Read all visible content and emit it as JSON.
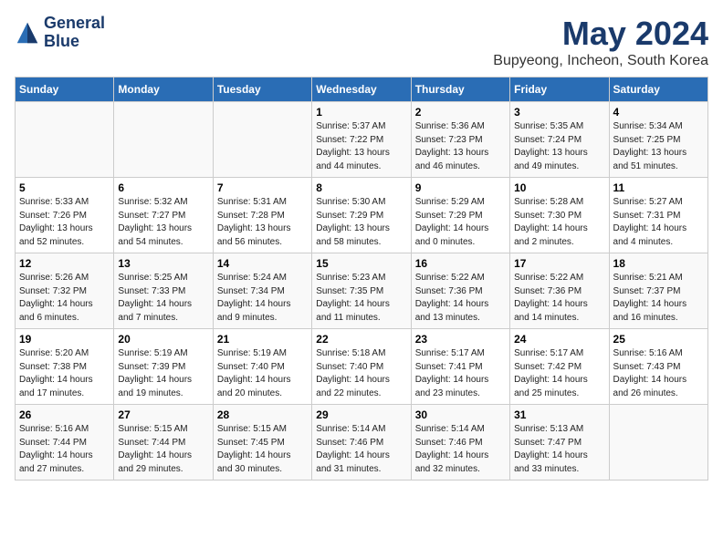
{
  "logo": {
    "line1": "General",
    "line2": "Blue"
  },
  "title": "May 2024",
  "location": "Bupyeong, Incheon, South Korea",
  "weekdays": [
    "Sunday",
    "Monday",
    "Tuesday",
    "Wednesday",
    "Thursday",
    "Friday",
    "Saturday"
  ],
  "weeks": [
    [
      {
        "day": "",
        "info": ""
      },
      {
        "day": "",
        "info": ""
      },
      {
        "day": "",
        "info": ""
      },
      {
        "day": "1",
        "info": "Sunrise: 5:37 AM\nSunset: 7:22 PM\nDaylight: 13 hours\nand 44 minutes."
      },
      {
        "day": "2",
        "info": "Sunrise: 5:36 AM\nSunset: 7:23 PM\nDaylight: 13 hours\nand 46 minutes."
      },
      {
        "day": "3",
        "info": "Sunrise: 5:35 AM\nSunset: 7:24 PM\nDaylight: 13 hours\nand 49 minutes."
      },
      {
        "day": "4",
        "info": "Sunrise: 5:34 AM\nSunset: 7:25 PM\nDaylight: 13 hours\nand 51 minutes."
      }
    ],
    [
      {
        "day": "5",
        "info": "Sunrise: 5:33 AM\nSunset: 7:26 PM\nDaylight: 13 hours\nand 52 minutes."
      },
      {
        "day": "6",
        "info": "Sunrise: 5:32 AM\nSunset: 7:27 PM\nDaylight: 13 hours\nand 54 minutes."
      },
      {
        "day": "7",
        "info": "Sunrise: 5:31 AM\nSunset: 7:28 PM\nDaylight: 13 hours\nand 56 minutes."
      },
      {
        "day": "8",
        "info": "Sunrise: 5:30 AM\nSunset: 7:29 PM\nDaylight: 13 hours\nand 58 minutes."
      },
      {
        "day": "9",
        "info": "Sunrise: 5:29 AM\nSunset: 7:29 PM\nDaylight: 14 hours\nand 0 minutes."
      },
      {
        "day": "10",
        "info": "Sunrise: 5:28 AM\nSunset: 7:30 PM\nDaylight: 14 hours\nand 2 minutes."
      },
      {
        "day": "11",
        "info": "Sunrise: 5:27 AM\nSunset: 7:31 PM\nDaylight: 14 hours\nand 4 minutes."
      }
    ],
    [
      {
        "day": "12",
        "info": "Sunrise: 5:26 AM\nSunset: 7:32 PM\nDaylight: 14 hours\nand 6 minutes."
      },
      {
        "day": "13",
        "info": "Sunrise: 5:25 AM\nSunset: 7:33 PM\nDaylight: 14 hours\nand 7 minutes."
      },
      {
        "day": "14",
        "info": "Sunrise: 5:24 AM\nSunset: 7:34 PM\nDaylight: 14 hours\nand 9 minutes."
      },
      {
        "day": "15",
        "info": "Sunrise: 5:23 AM\nSunset: 7:35 PM\nDaylight: 14 hours\nand 11 minutes."
      },
      {
        "day": "16",
        "info": "Sunrise: 5:22 AM\nSunset: 7:36 PM\nDaylight: 14 hours\nand 13 minutes."
      },
      {
        "day": "17",
        "info": "Sunrise: 5:22 AM\nSunset: 7:36 PM\nDaylight: 14 hours\nand 14 minutes."
      },
      {
        "day": "18",
        "info": "Sunrise: 5:21 AM\nSunset: 7:37 PM\nDaylight: 14 hours\nand 16 minutes."
      }
    ],
    [
      {
        "day": "19",
        "info": "Sunrise: 5:20 AM\nSunset: 7:38 PM\nDaylight: 14 hours\nand 17 minutes."
      },
      {
        "day": "20",
        "info": "Sunrise: 5:19 AM\nSunset: 7:39 PM\nDaylight: 14 hours\nand 19 minutes."
      },
      {
        "day": "21",
        "info": "Sunrise: 5:19 AM\nSunset: 7:40 PM\nDaylight: 14 hours\nand 20 minutes."
      },
      {
        "day": "22",
        "info": "Sunrise: 5:18 AM\nSunset: 7:40 PM\nDaylight: 14 hours\nand 22 minutes."
      },
      {
        "day": "23",
        "info": "Sunrise: 5:17 AM\nSunset: 7:41 PM\nDaylight: 14 hours\nand 23 minutes."
      },
      {
        "day": "24",
        "info": "Sunrise: 5:17 AM\nSunset: 7:42 PM\nDaylight: 14 hours\nand 25 minutes."
      },
      {
        "day": "25",
        "info": "Sunrise: 5:16 AM\nSunset: 7:43 PM\nDaylight: 14 hours\nand 26 minutes."
      }
    ],
    [
      {
        "day": "26",
        "info": "Sunrise: 5:16 AM\nSunset: 7:44 PM\nDaylight: 14 hours\nand 27 minutes."
      },
      {
        "day": "27",
        "info": "Sunrise: 5:15 AM\nSunset: 7:44 PM\nDaylight: 14 hours\nand 29 minutes."
      },
      {
        "day": "28",
        "info": "Sunrise: 5:15 AM\nSunset: 7:45 PM\nDaylight: 14 hours\nand 30 minutes."
      },
      {
        "day": "29",
        "info": "Sunrise: 5:14 AM\nSunset: 7:46 PM\nDaylight: 14 hours\nand 31 minutes."
      },
      {
        "day": "30",
        "info": "Sunrise: 5:14 AM\nSunset: 7:46 PM\nDaylight: 14 hours\nand 32 minutes."
      },
      {
        "day": "31",
        "info": "Sunrise: 5:13 AM\nSunset: 7:47 PM\nDaylight: 14 hours\nand 33 minutes."
      },
      {
        "day": "",
        "info": ""
      }
    ]
  ]
}
